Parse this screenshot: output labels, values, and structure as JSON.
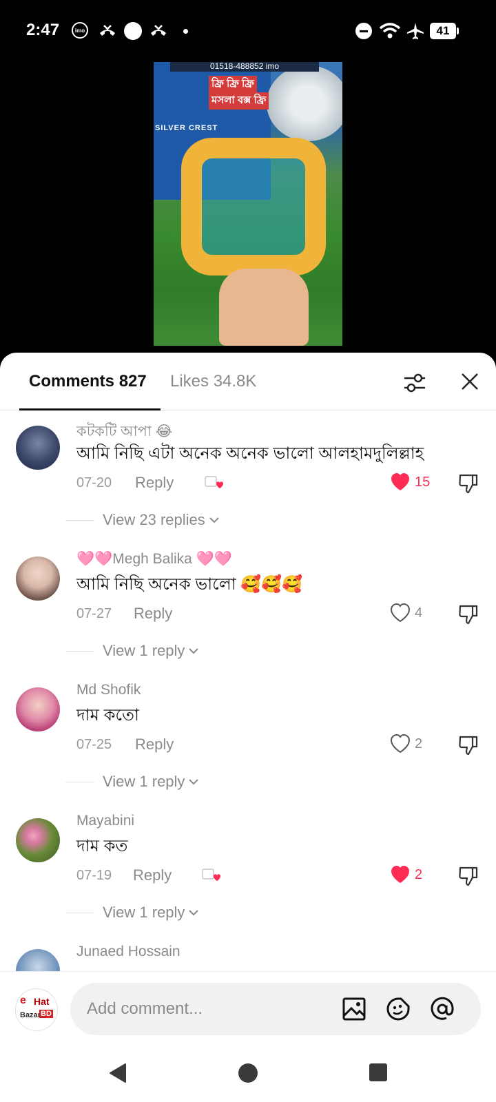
{
  "status_bar": {
    "time": "2:47",
    "imo_label": "imo",
    "battery": "41"
  },
  "video": {
    "banner_text": "01518-488852 imo",
    "overlay_line1": "ফ্রি ফ্রি ফ্রি",
    "overlay_line2": "মসলা বক্স ফ্রি",
    "brand": "SILVER CREST"
  },
  "tabs": {
    "comments_label": "Comments 827",
    "likes_label": "Likes 34.8K"
  },
  "comments": [
    {
      "author": "কটকটি আপা 😂",
      "text": "আমি নিছি এটা অনেক অনেক ভালো আলহামদুলিল্লাহ",
      "date": "07-20",
      "reply_label": "Reply",
      "likes": "15",
      "liked": true,
      "view_replies": "View 23 replies"
    },
    {
      "author": "🩷🩷Megh Balika 🩷🩷",
      "text": "আমি নিছি অনেক ভালো 🥰🥰🥰",
      "date": "07-27",
      "reply_label": "Reply",
      "likes": "4",
      "liked": false,
      "view_replies": "View 1 reply"
    },
    {
      "author": "Md Shofik",
      "text": "দাম কতো",
      "date": "07-25",
      "reply_label": "Reply",
      "likes": "2",
      "liked": false,
      "view_replies": "View 1 reply"
    },
    {
      "author": "Mayabini",
      "text": "দাম কত",
      "date": "07-19",
      "reply_label": "Reply",
      "likes": "2",
      "liked": true,
      "view_replies": "View 1 reply"
    },
    {
      "author": "Junaed Hossain"
    }
  ],
  "input": {
    "placeholder": "Add comment...",
    "avatar_e": "e",
    "avatar_hat": "Hat",
    "avatar_bazar": "Bazar",
    "avatar_bd": "BD"
  },
  "colors": {
    "accent": "#fe2c55",
    "muted_text": "#8a8a8a"
  }
}
